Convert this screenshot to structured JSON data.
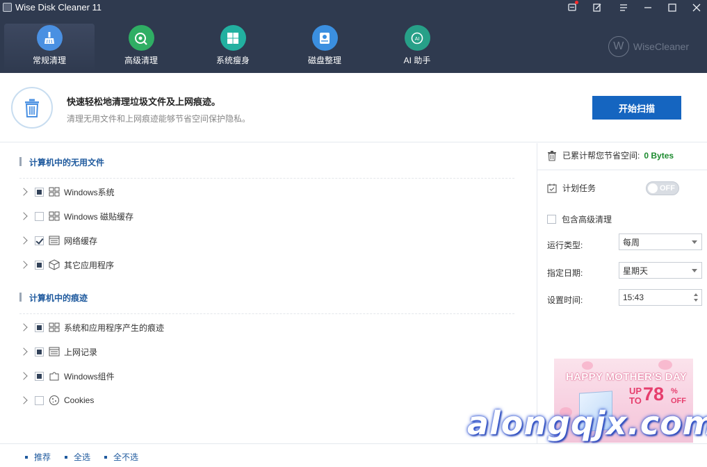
{
  "app": {
    "title": "Wise Disk Cleaner 11"
  },
  "nav": {
    "tabs": [
      {
        "label": "常规清理",
        "icon": "broom-icon",
        "color": "#4a90e2"
      },
      {
        "label": "高级清理",
        "icon": "disk-scan-icon",
        "color": "#2fae64"
      },
      {
        "label": "系统瘦身",
        "icon": "windows-icon",
        "color": "#22b0a0"
      },
      {
        "label": "磁盘整理",
        "icon": "disk-defrag-icon",
        "color": "#3b8fe0"
      },
      {
        "label": "AI 助手",
        "icon": "ai-icon",
        "color": "#27a088"
      }
    ],
    "brand": "WiseCleaner"
  },
  "banner": {
    "title": "快速轻松地清理垃圾文件及上网痕迹。",
    "subtitle": "清理无用文件和上网痕迹能够节省空间保护隐私。",
    "scan_button": "开始扫描"
  },
  "sections": [
    {
      "title": "计算机中的无用文件",
      "items": [
        {
          "label": "Windows系统",
          "check": "partial",
          "icon": "windows-grid-icon"
        },
        {
          "label": "Windows 磁贴缓存",
          "check": "unchecked",
          "icon": "windows-grid-icon"
        },
        {
          "label": "网络缓存",
          "check": "checked",
          "icon": "browser-window-icon"
        },
        {
          "label": "其它应用程序",
          "check": "partial",
          "icon": "package-box-icon"
        }
      ]
    },
    {
      "title": "计算机中的痕迹",
      "items": [
        {
          "label": "系统和应用程序产生的痕迹",
          "check": "partial",
          "icon": "windows-grid-icon"
        },
        {
          "label": "上网记录",
          "check": "partial",
          "icon": "browser-window-icon"
        },
        {
          "label": "Windows组件",
          "check": "partial",
          "icon": "puzzle-icon"
        },
        {
          "label": "Cookies",
          "check": "unchecked",
          "icon": "cookie-icon"
        }
      ]
    }
  ],
  "right": {
    "saved_label": "已累计帮您节省空间:",
    "saved_value": "0 Bytes",
    "schedule_label": "计划任务",
    "toggle_state": "OFF",
    "include_advanced": "包含高级清理",
    "run_type_label": "运行类型:",
    "run_type_value": "每周",
    "date_label": "指定日期:",
    "date_value": "星期天",
    "time_label": "设置时间:",
    "time_value": "15:43"
  },
  "ad": {
    "title": "HAPPY MOTHER'S DAY",
    "up": "UP",
    "to": "TO",
    "percent": "78",
    "pct_sign": "%",
    "off": "OFF"
  },
  "watermark": "alongqjx.com",
  "bottom": {
    "links": [
      "推荐",
      "全选",
      "全不选"
    ]
  }
}
